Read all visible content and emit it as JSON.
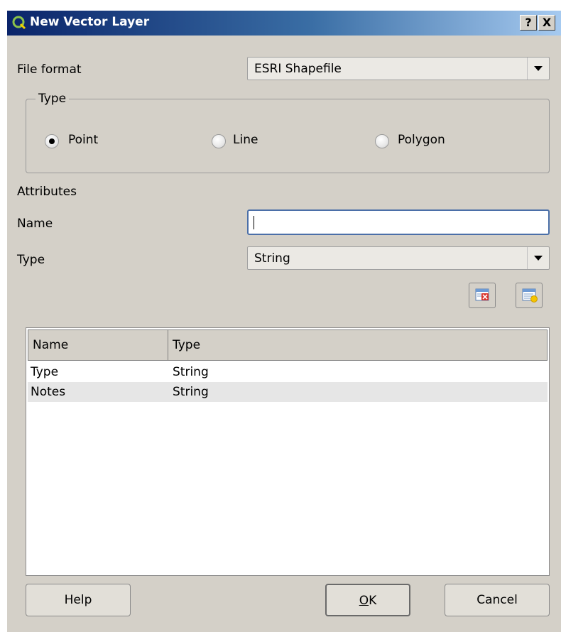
{
  "window": {
    "title": "New Vector Layer",
    "help_btn": "?",
    "close_btn": "X"
  },
  "file_format": {
    "label": "File format",
    "value": "ESRI Shapefile"
  },
  "geometry_type": {
    "group_label": "Type",
    "options": [
      "Point",
      "Line",
      "Polygon"
    ],
    "selected": "Point"
  },
  "attributes": {
    "section_label": "Attributes",
    "name_label": "Name",
    "name_value": "",
    "type_label": "Type",
    "type_value": "String",
    "remove_icon": "remove-attribute-icon",
    "add_icon": "add-attribute-icon"
  },
  "table": {
    "columns": [
      "Name",
      "Type"
    ],
    "rows": [
      {
        "name": "Type",
        "type": "String"
      },
      {
        "name": "Notes",
        "type": "String"
      }
    ]
  },
  "buttons": {
    "help": "Help",
    "ok_mnemonic": "O",
    "ok_rest": "K",
    "cancel": "Cancel"
  },
  "colors": {
    "title_bar_start": "#0a246a",
    "title_bar_end": "#a6caf0",
    "dialog_bg": "#d4d0c8",
    "focus_border": "#4b6fa8"
  }
}
